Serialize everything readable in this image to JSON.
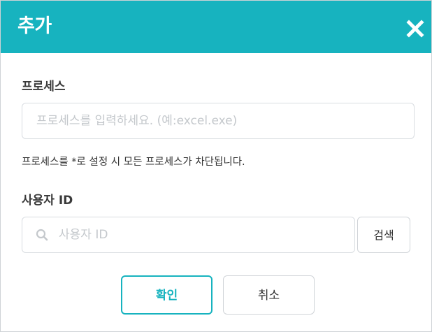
{
  "dialog": {
    "title": "추가",
    "close_icon": "close-x-icon"
  },
  "process": {
    "label": "프로세스",
    "placeholder": "프로세스를 입력하세요. (예:excel.exe)",
    "value": "",
    "help_text": "프로세스를 *로 설정 시 모든 프로세스가 차단됩니다."
  },
  "user": {
    "label": "사용자 ID",
    "placeholder": "사용자 ID",
    "value": "",
    "search_icon": "search-icon",
    "search_button": "검색"
  },
  "actions": {
    "confirm": "확인",
    "cancel": "취소"
  },
  "colors": {
    "accent": "#17b3bf",
    "header_text": "#ffffff",
    "border": "#d9dde1",
    "placeholder": "#c4c8cc"
  }
}
